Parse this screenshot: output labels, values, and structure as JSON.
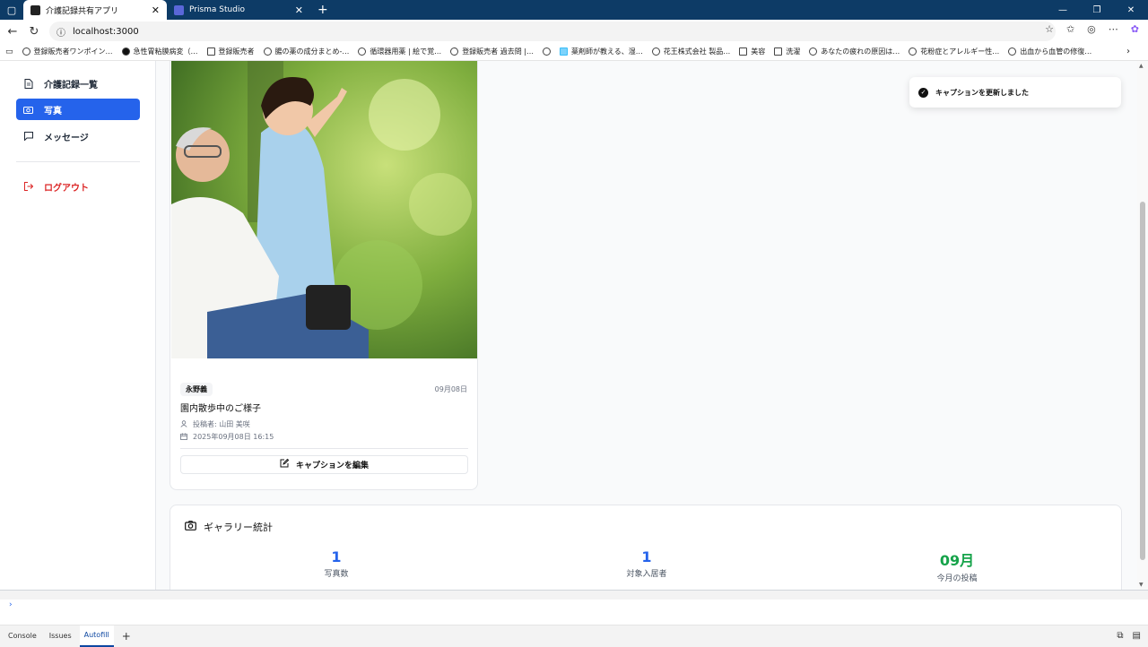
{
  "browser": {
    "tabs": [
      {
        "title": "介護記録共有アプリ",
        "active": true,
        "close": "✕"
      },
      {
        "title": "Prisma Studio",
        "active": false,
        "close": "✕"
      }
    ],
    "new_tab": "+",
    "url": "localhost:3000",
    "bookmarks": [
      {
        "label": "登録販売者ワンポイン…",
        "icon": "globe-icon"
      },
      {
        "label": "急性胃粘膜病変（…",
        "icon": "site-icon"
      },
      {
        "label": "登録販売者",
        "icon": "folder-icon"
      },
      {
        "label": "腸の薬の成分まとめ-…",
        "icon": "globe-icon"
      },
      {
        "label": "循環器用薬 | 絵で覚…",
        "icon": "globe-icon"
      },
      {
        "label": "登録販売者 過去問 |…",
        "icon": "globe-icon"
      },
      {
        "label": "",
        "icon": "globe-icon"
      },
      {
        "label": "薬剤師が教える、湿…",
        "icon": "site-icon"
      },
      {
        "label": "花王株式会社 製品…",
        "icon": "globe-icon"
      },
      {
        "label": "美容",
        "icon": "folder-icon"
      },
      {
        "label": "洗濯",
        "icon": "folder-icon"
      },
      {
        "label": "あなたの疲れの原因は…",
        "icon": "globe-icon"
      },
      {
        "label": "花粉症とアレルギー性…",
        "icon": "globe-icon"
      },
      {
        "label": "出血から血管の修復…",
        "icon": "globe-icon"
      }
    ]
  },
  "sidebar": {
    "items": [
      {
        "label": "介護記録一覧",
        "icon": "document-icon",
        "active": false
      },
      {
        "label": "写真",
        "icon": "camera-icon",
        "active": true
      },
      {
        "label": "メッセージ",
        "icon": "message-icon",
        "active": false
      }
    ],
    "logout": {
      "label": "ログアウト",
      "icon": "logout-icon"
    }
  },
  "photo_card": {
    "resident": "永野義",
    "date": "09月08日",
    "caption": "園内散歩中のご様子",
    "poster": "投稿者: 山田 美咲",
    "datetime": "2025年09月08日 16:15",
    "edit_label": "キャプションを編集"
  },
  "stats": {
    "title": "ギャラリー統計",
    "items": [
      {
        "value": "1",
        "label": "写真数",
        "color": "#2563eb"
      },
      {
        "value": "1",
        "label": "対象入居者",
        "color": "#2563eb"
      },
      {
        "value": "09月",
        "label": "今月の投稿",
        "color": "#16a34a"
      }
    ]
  },
  "toast": {
    "message": "キャプションを更新しました"
  },
  "devtools": {
    "prompt": "›",
    "tabs": [
      {
        "label": "Console",
        "active": false
      },
      {
        "label": "Issues",
        "active": false
      },
      {
        "label": "Autofill",
        "active": true
      }
    ],
    "add": "+"
  },
  "colors": {
    "primary": "#2563eb",
    "danger": "#dc2626",
    "success": "#16a34a",
    "browser_frame": "#0d3b66"
  }
}
